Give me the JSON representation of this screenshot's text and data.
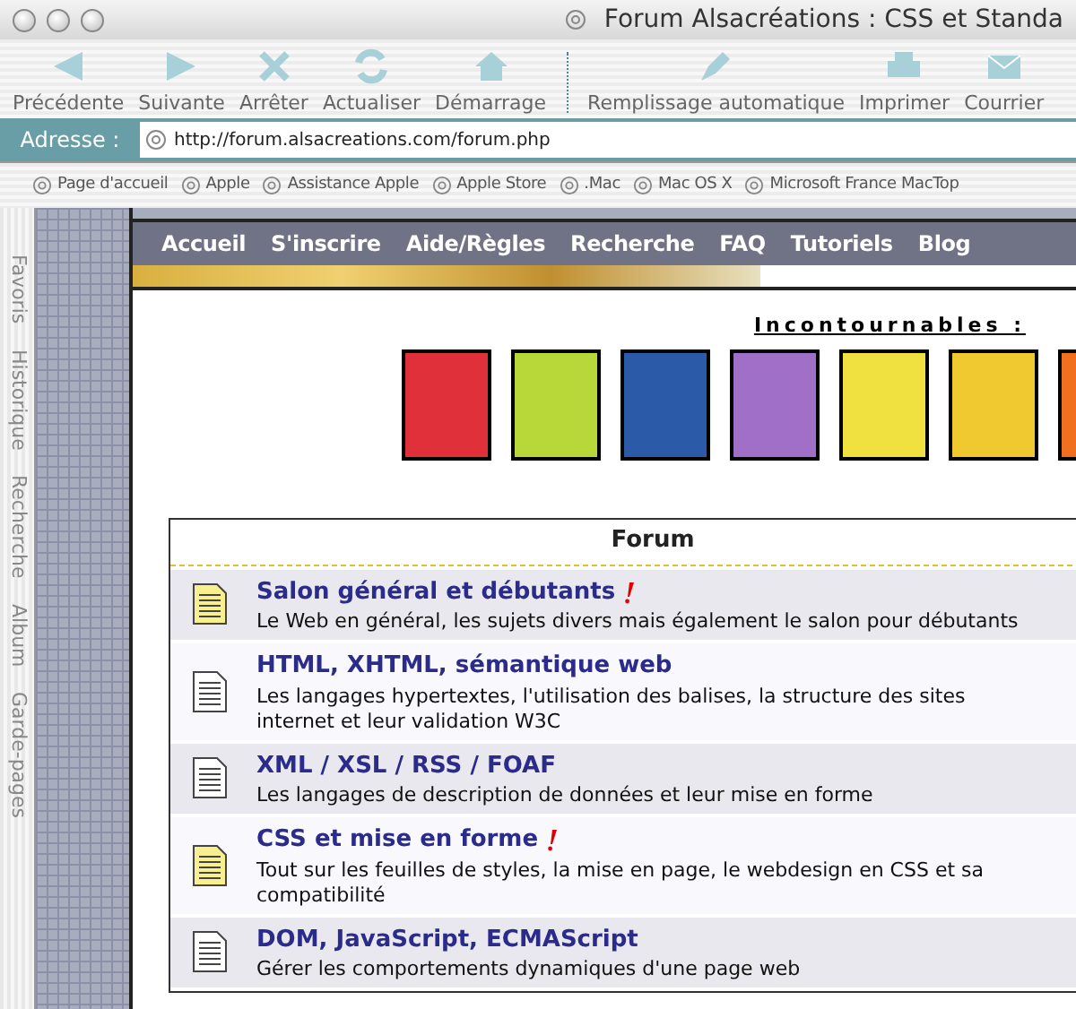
{
  "window": {
    "title": "Forum Alsacréations : CSS et Standa"
  },
  "toolbar": [
    {
      "label": "Précédente",
      "kind": "back"
    },
    {
      "label": "Suivante",
      "kind": "forward"
    },
    {
      "label": "Arrêter",
      "kind": "stop"
    },
    {
      "label": "Actualiser",
      "kind": "refresh"
    },
    {
      "label": "Démarrage",
      "kind": "home"
    },
    {
      "label": "Remplissage automatique",
      "kind": "autofill"
    },
    {
      "label": "Imprimer",
      "kind": "print"
    },
    {
      "label": "Courrier",
      "kind": "mail"
    }
  ],
  "address_bar": {
    "label": "Adresse :",
    "value": "http://forum.alsacreations.com/forum.php"
  },
  "favorites_bar": [
    "Page d'accueil",
    "Apple",
    "Assistance Apple",
    "Apple Store",
    ".Mac",
    "Mac OS X",
    "Microsoft France MacTop"
  ],
  "side_tabs": [
    "Favoris",
    "Historique",
    "Recherche",
    "Album",
    "Garde-pages"
  ],
  "nav": [
    "Accueil",
    "S'inscrire",
    "Aide/Règles",
    "Recherche",
    "FAQ",
    "Tutoriels",
    "Blog"
  ],
  "featured": {
    "title": "Incontournables :",
    "book_covers": [
      {
        "color": "#e0303a"
      },
      {
        "color": "#b8d83a"
      },
      {
        "color": "#2a5aa8"
      },
      {
        "color": "#a070c8"
      },
      {
        "color": "#f0e040"
      },
      {
        "color": "#f0c830"
      },
      {
        "color": "#f07020"
      }
    ]
  },
  "forum": {
    "title": "Forum",
    "rows": [
      {
        "title": "Salon général et débutants",
        "description": "Le Web en général, les sujets divers mais également le salon pour débutants",
        "unread": true
      },
      {
        "title": "HTML, XHTML, sémantique web",
        "description": "Les langages hypertextes, l'utilisation des balises, la structure des sites internet et leur validation W3C",
        "unread": false
      },
      {
        "title": "XML / XSL / RSS / FOAF",
        "description": "Les langages de description de données et leur mise en forme",
        "unread": false
      },
      {
        "title": "CSS et mise en forme",
        "description": "Tout sur les feuilles de styles, la mise en page, le webdesign en CSS et sa compatibilité",
        "unread": true
      },
      {
        "title": "DOM, JavaScript, ECMAScript",
        "description": "Gérer les comportements dynamiques d'une page web",
        "unread": false
      }
    ]
  }
}
